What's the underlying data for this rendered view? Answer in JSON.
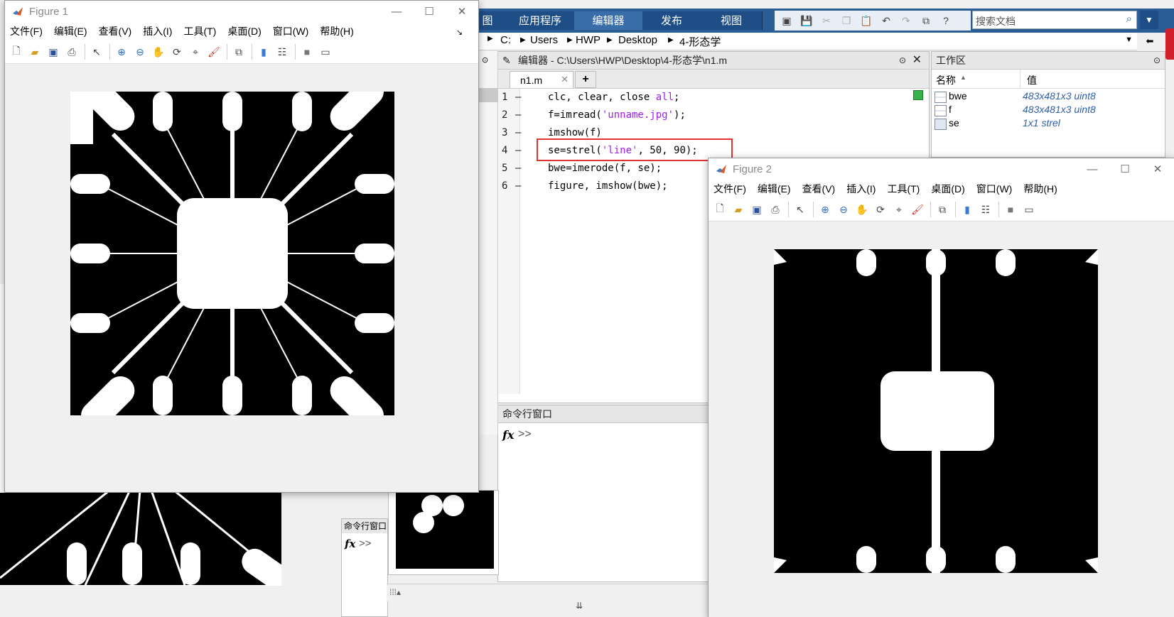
{
  "matlab": {
    "ribbon_tabs": [
      {
        "label": "图"
      },
      {
        "label": "应用程序"
      },
      {
        "label": "编辑器"
      },
      {
        "label": "发布"
      },
      {
        "label": "视图"
      }
    ],
    "search_placeholder": "搜索文档",
    "path": {
      "drive": "C:",
      "segments": [
        "Users",
        "HWP",
        "Desktop",
        "4-形态学"
      ]
    },
    "editor": {
      "title": "编辑器 - C:\\Users\\HWP\\Desktop\\4-形态学\\n1.m",
      "tab": "n1.m",
      "add_tab": "+",
      "lines": [
        {
          "num": "1",
          "dash": "—",
          "pre": "clc, clear, close ",
          "str": "all",
          "post": ";"
        },
        {
          "num": "2",
          "dash": "—",
          "pre": "f=imread(",
          "str": "'unname.jpg'",
          "post": ");"
        },
        {
          "num": "3",
          "dash": "—",
          "pre": "imshow(f)",
          "str": "",
          "post": ""
        },
        {
          "num": "4",
          "dash": "—",
          "pre": "se=strel(",
          "str": "'line'",
          "post": ", 50, 90);"
        },
        {
          "num": "5",
          "dash": "—",
          "pre": "bwe=imerode(f, se);",
          "str": "",
          "post": ""
        },
        {
          "num": "6",
          "dash": "—",
          "pre": "figure, imshow(bwe);",
          "str": "",
          "post": ""
        }
      ],
      "highlighted_line": 4
    },
    "command_window": {
      "title": "命令行窗口",
      "prompt": ">>",
      "fx": "fx"
    },
    "workspace": {
      "title": "工作区",
      "col_name": "名称",
      "col_value": "值",
      "vars": [
        {
          "name": "bwe",
          "value": "483x481x3 uint8"
        },
        {
          "name": "f",
          "value": "483x481x3 uint8"
        },
        {
          "name": "se",
          "value": "1x1 strel"
        }
      ]
    },
    "bg_command": {
      "title": "命令行窗口",
      "prompt": ">>",
      "fx": "fx"
    }
  },
  "figure_menus": [
    "文件(F)",
    "编辑(E)",
    "查看(V)",
    "插入(I)",
    "工具(T)",
    "桌面(D)",
    "窗口(W)",
    "帮助(H)"
  ],
  "figure1": {
    "title": "Figure 1"
  },
  "figure2": {
    "title": "Figure 2"
  },
  "colors": {
    "ribbon_dark": "#1f4e86",
    "highlight_box": "#e53030",
    "workspace_value": "#2f5fa8",
    "string": "#a020f0"
  }
}
